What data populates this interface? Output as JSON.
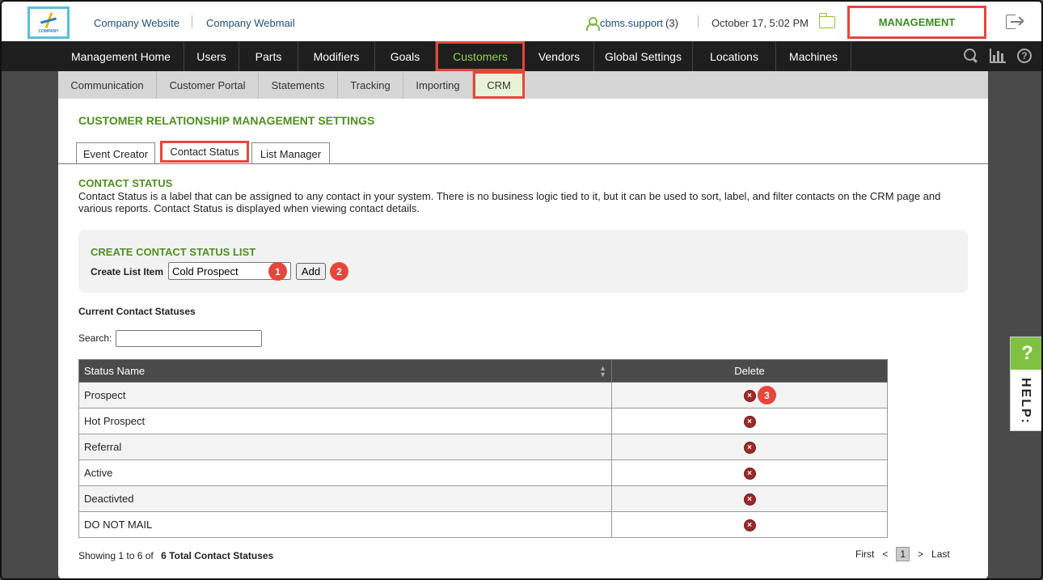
{
  "header": {
    "logo_text": "COMPANY",
    "links": [
      "Company Website",
      "Company Webmail"
    ],
    "user_name": "cbms.support",
    "user_count": "(3)",
    "datetime": "October 17, 5:02 PM",
    "management_label": "MANAGEMENT"
  },
  "mainnav": {
    "items": [
      "Management Home",
      "Users",
      "Parts",
      "Modifiers",
      "Goals",
      "Customers",
      "Vendors",
      "Global Settings",
      "Locations",
      "Machines"
    ],
    "active": "Customers"
  },
  "subnav": {
    "items": [
      "Communication",
      "Customer Portal",
      "Statements",
      "Tracking",
      "Importing",
      "CRM"
    ],
    "active": "CRM"
  },
  "page": {
    "title": "CUSTOMER RELATIONSHIP MANAGEMENT SETTINGS",
    "tabs": [
      "Event Creator",
      "Contact Status",
      "List Manager"
    ],
    "active_tab": "Contact Status",
    "section_title": "CONTACT STATUS",
    "description": "Contact Status is a label that can be assigned to any contact in your system. There is no business logic tied to it, but it can be used to sort, label, and filter contacts on the CRM page and various reports. Contact Status is displayed when viewing contact details."
  },
  "create": {
    "title": "CREATE CONTACT STATUS LIST",
    "label": "Create List Item",
    "input_value": "Cold Prospect",
    "add_label": "Add"
  },
  "list": {
    "title": "Current Contact Statuses",
    "search_label": "Search:",
    "search_value": "",
    "columns": [
      "Status Name",
      "Delete"
    ],
    "rows": [
      "Prospect",
      "Hot Prospect",
      "Referral",
      "Active",
      "Deactivted",
      "DO NOT MAIL"
    ],
    "showing": "Showing 1 to 6 of",
    "total": "6 Total Contact Statuses"
  },
  "pager": {
    "first": "First",
    "prev": "<",
    "current": "1",
    "next": ">",
    "last": "Last"
  },
  "markers": [
    "1",
    "2",
    "3"
  ],
  "help": {
    "q": "?",
    "label": "HELP:"
  },
  "colors": {
    "accent_green": "#4f8f23",
    "highlight_red": "#e8453c",
    "nav_dark": "#1e1e1e"
  }
}
